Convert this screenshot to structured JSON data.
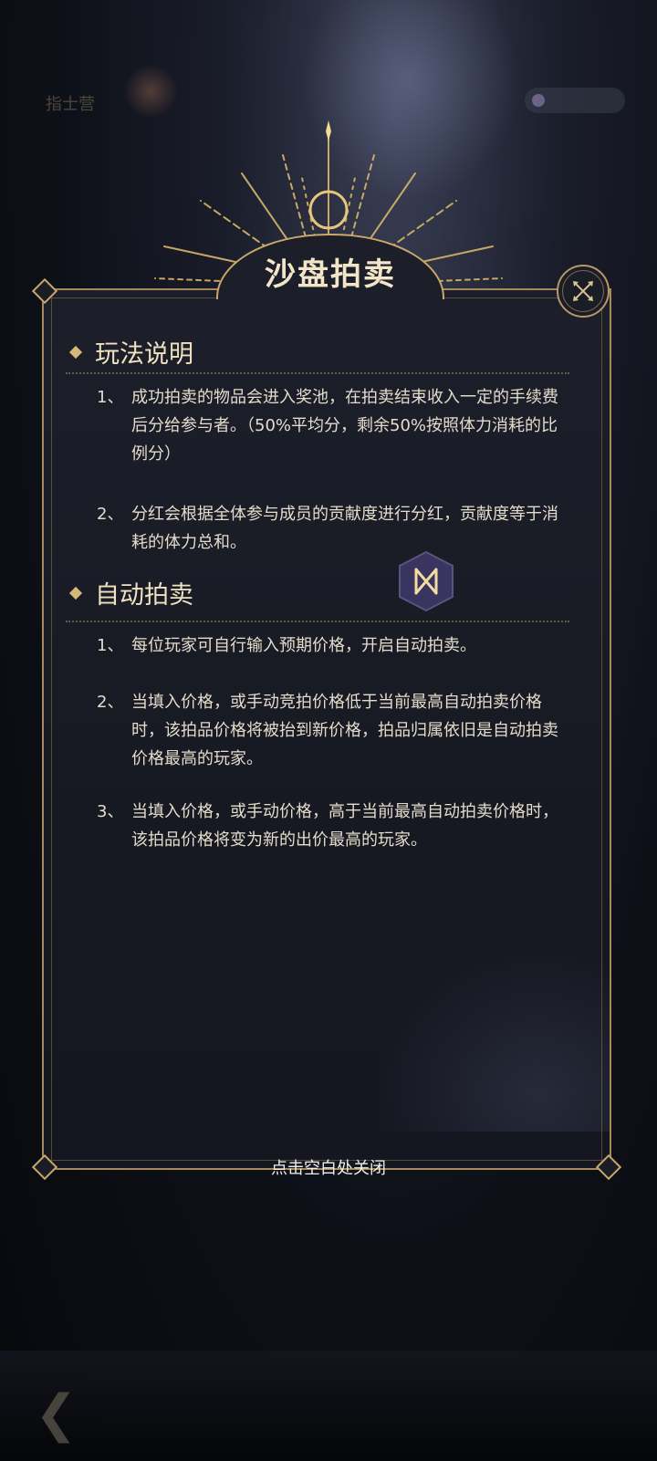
{
  "background": {
    "badge_text": "指士营",
    "accent_gold": "#c9a86a",
    "panel_color": "#1c1e2a"
  },
  "dialog": {
    "title": "沙盘拍卖",
    "close_icon": "close-x-icon",
    "sections": [
      {
        "title": "玩法说明",
        "items": [
          {
            "num": "1、",
            "text": "成功拍卖的物品会进入奖池，在拍卖结束收入一定的手续费后分给参与者。（50%平均分，剩余50%按照体力消耗的比例分）"
          },
          {
            "num": "2、",
            "text": "分红会根据全体参与成员的贡献度进行分红，贡献度等于消耗的体力总和。"
          }
        ]
      },
      {
        "title": "自动拍卖",
        "items": [
          {
            "num": "1、",
            "text": "每位玩家可自行输入预期价格，开启自动拍卖。"
          },
          {
            "num": "2、",
            "text": "当填入价格，或手动竞拍价格低于当前最高自动拍卖价格时，该拍品价格将被抬到新价格，拍品归属依旧是自动拍卖价格最高的玩家。"
          },
          {
            "num": "3、",
            "text": "当填入价格，或手动价格，高于当前最高自动拍卖价格时，该拍品价格将变为新的出价最高的玩家。"
          }
        ]
      }
    ],
    "tap_to_close": "点击空白处关闭"
  }
}
